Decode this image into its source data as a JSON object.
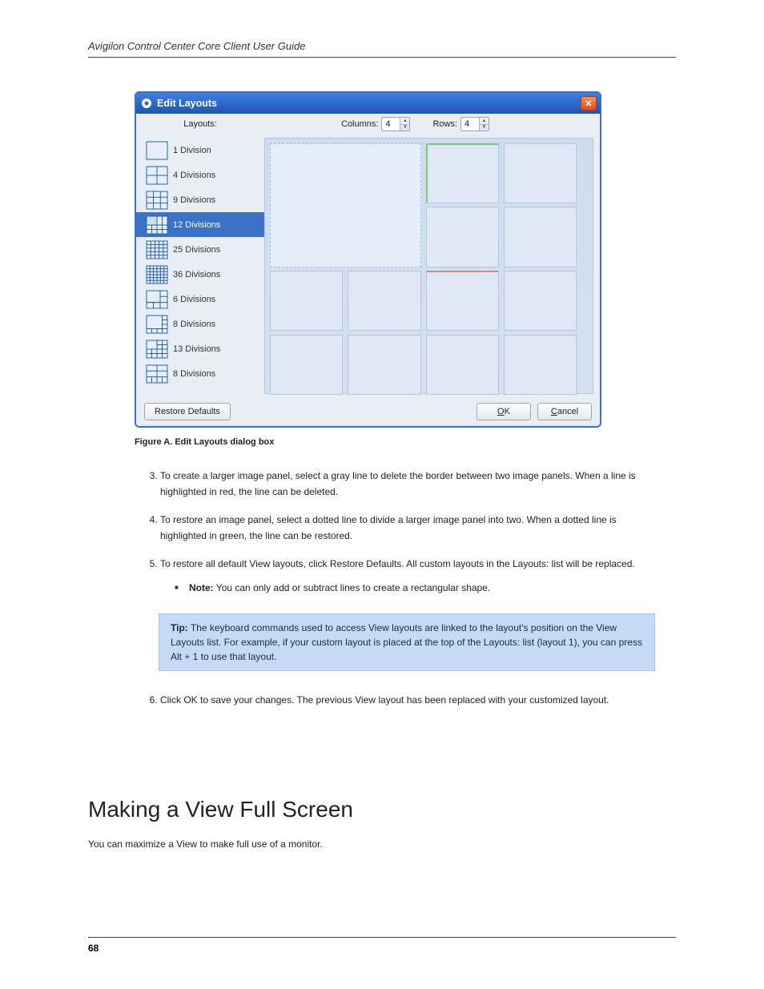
{
  "header": {
    "doc_title": "Avigilon Control Center Core Client User Guide"
  },
  "dialog": {
    "title": "Edit Layouts",
    "layouts_label": "Layouts:",
    "columns_label": "Columns:",
    "rows_label": "Rows:",
    "columns_value": "4",
    "rows_value": "4",
    "restore_label": "Restore Defaults",
    "ok_label": "K",
    "ok_prefix": "O",
    "cancel_label": "ancel",
    "cancel_prefix": "C",
    "layouts": [
      {
        "label": "1 Division"
      },
      {
        "label": "4 Divisions"
      },
      {
        "label": "9 Divisions"
      },
      {
        "label": "12 Divisions"
      },
      {
        "label": "25 Divisions"
      },
      {
        "label": "36 Divisions"
      },
      {
        "label": "6 Divisions"
      },
      {
        "label": "8 Divisions"
      },
      {
        "label": "13 Divisions"
      },
      {
        "label": "8 Divisions"
      }
    ]
  },
  "figure": {
    "prefix": "Figure A.",
    "caption": " Edit Layouts dialog box"
  },
  "instructions": {
    "intro_3": "To create a larger image panel, select a gray line to delete the border between two image panels. When a line is highlighted in red, the line can be deleted.",
    "intro_4": "To restore an image panel, select a dotted line to divide a larger image panel into two. When a dotted line is highlighted in green, the line can be restored.",
    "intro_5": "To restore all default View layouts, click Restore Defaults. All custom layouts in the Layouts: list will be replaced.",
    "note": "You can only add or subtract lines to create a rectangular shape.",
    "step6": "Click OK to save your changes. The previous View layout has been replaced with your customized layout.",
    "tip_label": "Tip:",
    "tip_body": " The keyboard commands used to access View layouts are linked to the layout's position on the View Layouts list. For example, if your custom layout is placed at the top of the Layouts: list (layout 1), you can press Alt + 1 to use that layout."
  },
  "section": {
    "heading": "Making a View Full Screen",
    "body": "You can maximize a View to make full use of a monitor."
  },
  "footer": {
    "page": "68"
  }
}
